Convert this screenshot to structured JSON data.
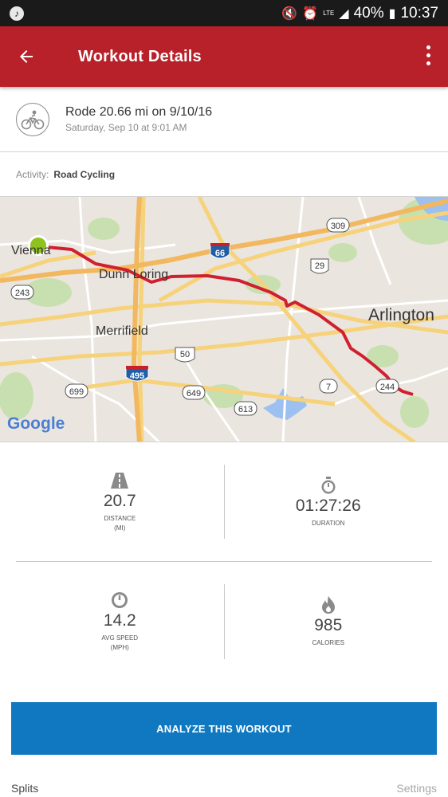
{
  "status_bar": {
    "battery": "40%",
    "time": "10:37",
    "network": "LTE"
  },
  "app_bar": {
    "title": "Workout Details"
  },
  "summary": {
    "title": "Rode 20.66 mi on 9/10/16",
    "subtitle": "Saturday, Sep 10 at 9:01 AM"
  },
  "activity": {
    "label": "Activity:",
    "value": "Road Cycling"
  },
  "map": {
    "labels": {
      "vienna": "Vienna",
      "dunn_loring": "Dunn Loring",
      "merrifield": "Merrifield",
      "arlington": "Arlington",
      "google": "Google"
    },
    "shields": {
      "i66": "66",
      "i495": "495",
      "r309": "309",
      "r29": "29",
      "r243": "243",
      "r50": "50",
      "r699": "699",
      "r649": "649",
      "r613": "613",
      "r7": "7",
      "r244": "244"
    },
    "route_color": "#d02030",
    "start_color": "#8dc21f"
  },
  "stats": [
    {
      "value": "20.7",
      "label": "DISTANCE",
      "unit": "(MI)",
      "icon": "road-icon"
    },
    {
      "value": "01:27:26",
      "label": "DURATION",
      "unit": "",
      "icon": "stopwatch-icon"
    },
    {
      "value": "14.2",
      "label": "AVG SPEED",
      "unit": "(MPH)",
      "icon": "speedometer-icon"
    },
    {
      "value": "985",
      "label": "CALORIES",
      "unit": "",
      "icon": "flame-icon"
    }
  ],
  "analyze_button": "ANALYZE THIS WORKOUT",
  "splits": {
    "label": "Splits",
    "settings": "Settings"
  },
  "colors": {
    "brand_red": "#b8202a",
    "button_blue": "#0f78c0"
  }
}
